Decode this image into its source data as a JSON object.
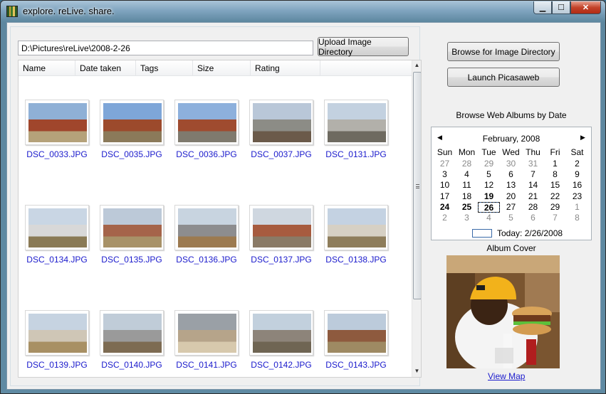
{
  "window": {
    "title": "explore. reLive. share.",
    "caption_buttons": [
      "minimize",
      "maximize",
      "close"
    ]
  },
  "directory": {
    "path": "D:\\Pictures\\reLive\\2008-2-26",
    "upload_label": "Upload Image Directory"
  },
  "list": {
    "columns": [
      "Name",
      "Date taken",
      "Tags",
      "Size",
      "Rating"
    ],
    "items": [
      {
        "name": "DSC_0033.JPG",
        "icon": "photo-thumbnail-campus-building"
      },
      {
        "name": "DSC_0035.JPG",
        "icon": "photo-thumbnail-brick-building"
      },
      {
        "name": "DSC_0036.JPG",
        "icon": "photo-thumbnail-brick-building"
      },
      {
        "name": "DSC_0037.JPG",
        "icon": "photo-thumbnail-building-corner"
      },
      {
        "name": "DSC_0131.JPG",
        "icon": "photo-thumbnail-parking-lot"
      },
      {
        "name": "DSC_0134.JPG",
        "icon": "photo-thumbnail-satellite-dish"
      },
      {
        "name": "DSC_0135.JPG",
        "icon": "photo-thumbnail-campus-field"
      },
      {
        "name": "DSC_0136.JPG",
        "icon": "photo-thumbnail-sculpture"
      },
      {
        "name": "DSC_0137.JPG",
        "icon": "photo-thumbnail-garage-doors"
      },
      {
        "name": "DSC_0138.JPG",
        "icon": "photo-thumbnail-white-buildings"
      },
      {
        "name": "DSC_0139.JPG",
        "icon": "photo-thumbnail-distant-buildings"
      },
      {
        "name": "DSC_0140.JPG",
        "icon": "photo-thumbnail-ring-sculpture"
      },
      {
        "name": "DSC_0141.JPG",
        "icon": "photo-thumbnail-stone-wall-sign"
      },
      {
        "name": "DSC_0142.JPG",
        "icon": "photo-thumbnail-modern-building"
      },
      {
        "name": "DSC_0143.JPG",
        "icon": "photo-thumbnail-brick-building"
      }
    ]
  },
  "side": {
    "browse_label": "Browse for Image Directory",
    "launch_label": "Launch Picasaweb",
    "albums_label": "Browse Web Albums by Date",
    "album_cover_label": "Album Cover",
    "view_map_label": "View Map"
  },
  "calendar": {
    "month": "February, 2008",
    "dows": [
      "Sun",
      "Mon",
      "Tue",
      "Wed",
      "Thu",
      "Fri",
      "Sat"
    ],
    "weeks": [
      [
        "27",
        "28",
        "29",
        "30",
        "31",
        "1",
        "2"
      ],
      [
        "3",
        "4",
        "5",
        "6",
        "7",
        "8",
        "9"
      ],
      [
        "10",
        "11",
        "12",
        "13",
        "14",
        "15",
        "16"
      ],
      [
        "17",
        "18",
        "19",
        "20",
        "21",
        "22",
        "23"
      ],
      [
        "24",
        "25",
        "26",
        "27",
        "28",
        "29",
        "1"
      ],
      [
        "2",
        "3",
        "4",
        "5",
        "6",
        "7",
        "8"
      ]
    ],
    "today_label": "Today: 2/26/2008"
  }
}
